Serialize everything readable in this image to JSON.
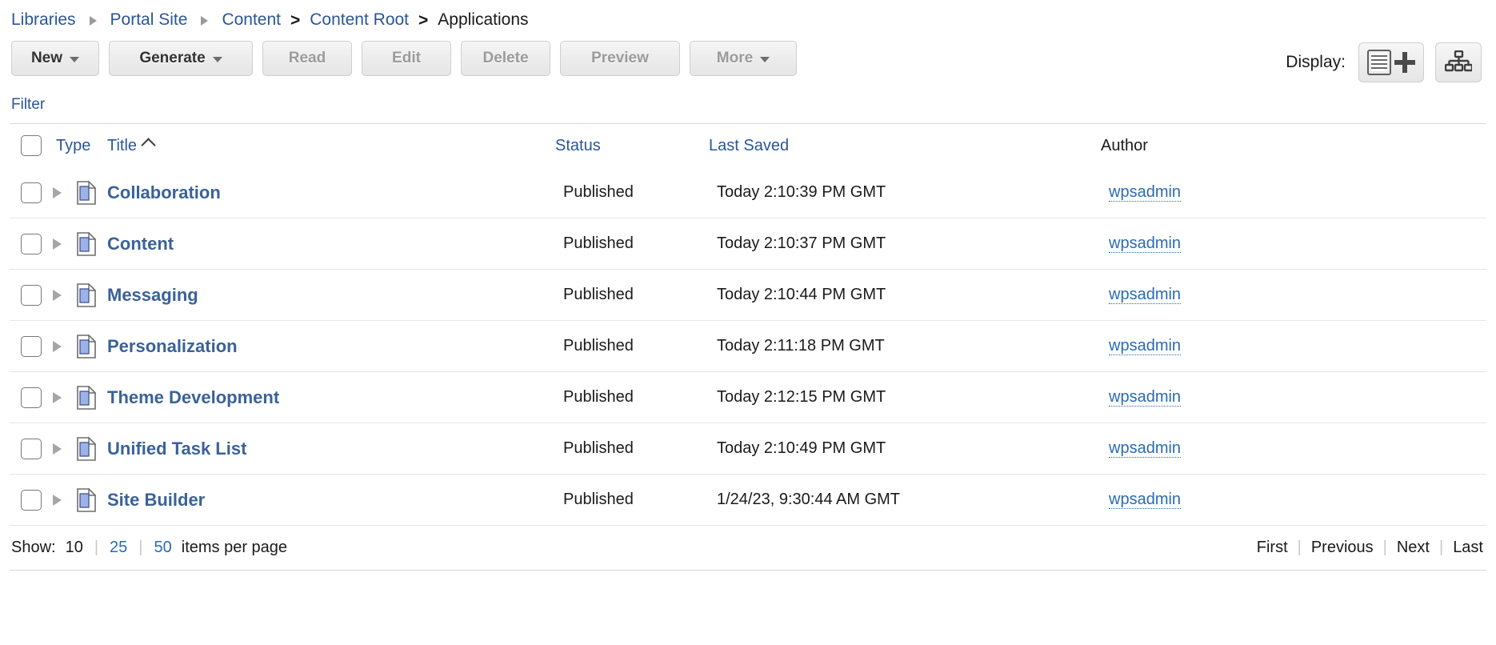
{
  "breadcrumb": {
    "items": [
      {
        "label": "Libraries",
        "type": "link",
        "sep": "triangle"
      },
      {
        "label": "Portal Site",
        "type": "link",
        "sep": "triangle"
      },
      {
        "label": "Content",
        "type": "link",
        "sep": "gt"
      },
      {
        "label": "Content Root",
        "type": "link",
        "sep": "gt"
      },
      {
        "label": "Applications",
        "type": "current",
        "sep": ""
      }
    ],
    "sep_gt": ">"
  },
  "toolbar": {
    "new_label": "New",
    "generate_label": "Generate",
    "read_label": "Read",
    "edit_label": "Edit",
    "delete_label": "Delete",
    "preview_label": "Preview",
    "more_label": "More",
    "display_label": "Display:",
    "list_icon": "list-view-icon",
    "plus_icon": "plus-icon",
    "tree_icon": "tree-view-icon"
  },
  "filter": {
    "label": "Filter"
  },
  "table": {
    "columns": {
      "type": "Type",
      "title": "Title",
      "status": "Status",
      "last_saved": "Last Saved",
      "author": "Author"
    },
    "sort": {
      "column": "Title",
      "direction": "ascending",
      "caret": "caret-up-icon"
    },
    "rows": [
      {
        "title": "Collaboration",
        "status": "Published",
        "last_saved": "Today 2:10:39 PM GMT",
        "author": "wpsadmin",
        "icon": "document-icon"
      },
      {
        "title": "Content",
        "status": "Published",
        "last_saved": "Today 2:10:37 PM GMT",
        "author": "wpsadmin",
        "icon": "document-icon"
      },
      {
        "title": "Messaging",
        "status": "Published",
        "last_saved": "Today 2:10:44 PM GMT",
        "author": "wpsadmin",
        "icon": "document-icon"
      },
      {
        "title": "Personalization",
        "status": "Published",
        "last_saved": "Today 2:11:18 PM GMT",
        "author": "wpsadmin",
        "icon": "document-icon"
      },
      {
        "title": "Theme Development",
        "status": "Published",
        "last_saved": "Today 2:12:15 PM GMT",
        "author": "wpsadmin",
        "icon": "document-icon"
      },
      {
        "title": "Unified Task List",
        "status": "Published",
        "last_saved": "Today 2:10:49 PM GMT",
        "author": "wpsadmin",
        "icon": "document-icon"
      },
      {
        "title": "Site Builder",
        "status": "Published",
        "last_saved": "1/24/23, 9:30:44 AM GMT",
        "author": "wpsadmin",
        "icon": "document-icon"
      }
    ]
  },
  "footer": {
    "show_label": "Show:",
    "page_sizes": [
      {
        "value": "10",
        "active": true
      },
      {
        "value": "25",
        "active": false
      },
      {
        "value": "50",
        "active": false
      }
    ],
    "items_label": "items per page",
    "separator": "|",
    "pager": [
      {
        "label": "First"
      },
      {
        "label": "Previous"
      },
      {
        "label": "Next"
      },
      {
        "label": "Last"
      }
    ]
  },
  "colors": {
    "link": "#2a5699",
    "title_link": "#3a6298",
    "author_link": "#2a6bb5",
    "text": "#1a1a1a",
    "disabled_button_text": "#9b9b9b"
  }
}
